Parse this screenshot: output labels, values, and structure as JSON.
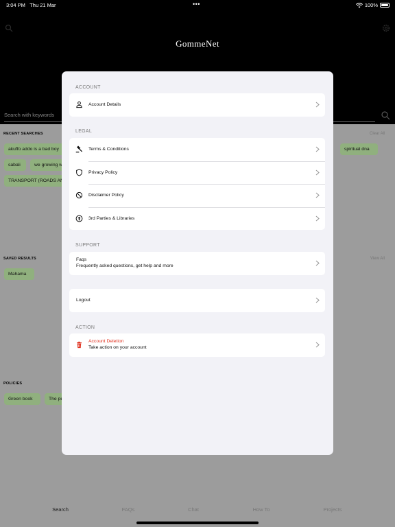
{
  "status_bar": {
    "time": "3:04 PM",
    "date": "Thu 21 Mar",
    "dots": "•••",
    "battery": "100%"
  },
  "header": {
    "brand": "GommeNet",
    "search_placeholder": "Search with keywords"
  },
  "recent_searches": {
    "title": "RECENT SEARCHES",
    "clear_label": "Clear All",
    "chips": [
      "akuffo addo is a bad boy",
      "spiritual dna",
      "sabali",
      "we growing w",
      "TRANSPORT (ROADS AN"
    ]
  },
  "saved_results": {
    "title": "SAVED RESULTS",
    "view_all": "View All",
    "chips": [
      "Mahama"
    ]
  },
  "policies": {
    "title": "POLICIES",
    "chips": [
      "Green book",
      "The pe"
    ]
  },
  "tabs": [
    "Search",
    "FAQs",
    "Chat",
    "How To",
    "Projects"
  ],
  "modal": {
    "account": {
      "label": "ACCOUNT",
      "items": [
        {
          "label": "Account Details",
          "icon": "person-icon"
        }
      ]
    },
    "legal": {
      "label": "LEGAL",
      "items": [
        {
          "label": "Terms  &  Conditions",
          "icon": "gavel-icon"
        },
        {
          "label": "Privacy Policy",
          "icon": "shield-icon"
        },
        {
          "label": "Disclaimer Policy",
          "icon": "block-icon"
        },
        {
          "label": "3rd Parties  &  Libraries",
          "icon": "arrow-up-circle-icon"
        }
      ]
    },
    "support": {
      "label": "SUPPORT",
      "faqs_title": "Faqs",
      "faqs_subtitle": "Frequently asked questions, get help and more"
    },
    "logout_label": "Logout",
    "action": {
      "label": "ACTION",
      "deletion_title": "Account Deletion",
      "deletion_subtitle": "Take action on your account",
      "danger_color": "#e0301e"
    }
  }
}
